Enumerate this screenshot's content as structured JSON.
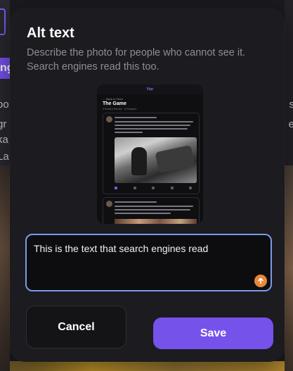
{
  "background": {
    "left_tag_label": "ng",
    "left_lines": [
      "oo",
      "gr",
      "ka",
      "La"
    ],
    "right_lines": [
      "s",
      "e"
    ]
  },
  "modal": {
    "title": "Alt text",
    "description": "Describe the photo for people who cannot see it. Search engines read this too.",
    "preview": {
      "logo": "Vipr",
      "back": "← Back to Feed",
      "heading": "The Game",
      "subheading": "4 Posts in this list · 12 Readers"
    },
    "alt_text_input": {
      "value": "This is the text that search engines read",
      "placeholder": ""
    },
    "submit_icon": "arrow-up-icon",
    "cancel_label": "Cancel",
    "save_label": "Save"
  },
  "colors": {
    "accent": "#7552ea",
    "focus_ring": "#7e9ae6",
    "submit": "#e8873a",
    "modal_bg": "#1c1b1f"
  }
}
